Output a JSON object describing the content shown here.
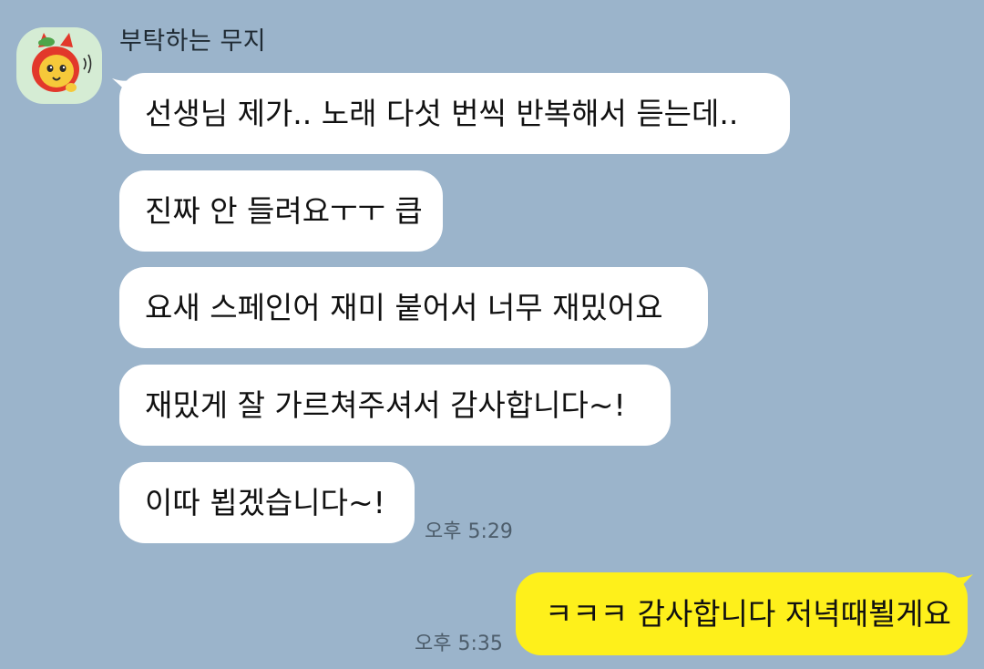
{
  "chat": {
    "sender_name": "부탁하는 무지",
    "messages": [
      {
        "text": "선생님 제가.. 노래 다섯 번씩 반복해서 듣는데.."
      },
      {
        "text": "진짜 안 들려요ㅜㅜ 큽"
      },
      {
        "text": "요새 스페인어 재미 붙어서 너무 재밌어요"
      },
      {
        "text": "재밌게 잘 가르쳐주셔서 감사합니다~!"
      },
      {
        "text": "이따 뵙겠습니다~!"
      }
    ],
    "received_time": "오후 5:29",
    "my_message": {
      "text": "ㅋㅋㅋ 감사합니다 저녁때뵐게요"
    },
    "sent_time": "오후 5:35"
  },
  "colors": {
    "background": "#9bb4cb",
    "incoming_bubble": "#ffffff",
    "outgoing_bubble": "#fef01b",
    "avatar_bg": "#d5ecd4"
  },
  "icons": {
    "avatar": "profile-avatar-character"
  }
}
